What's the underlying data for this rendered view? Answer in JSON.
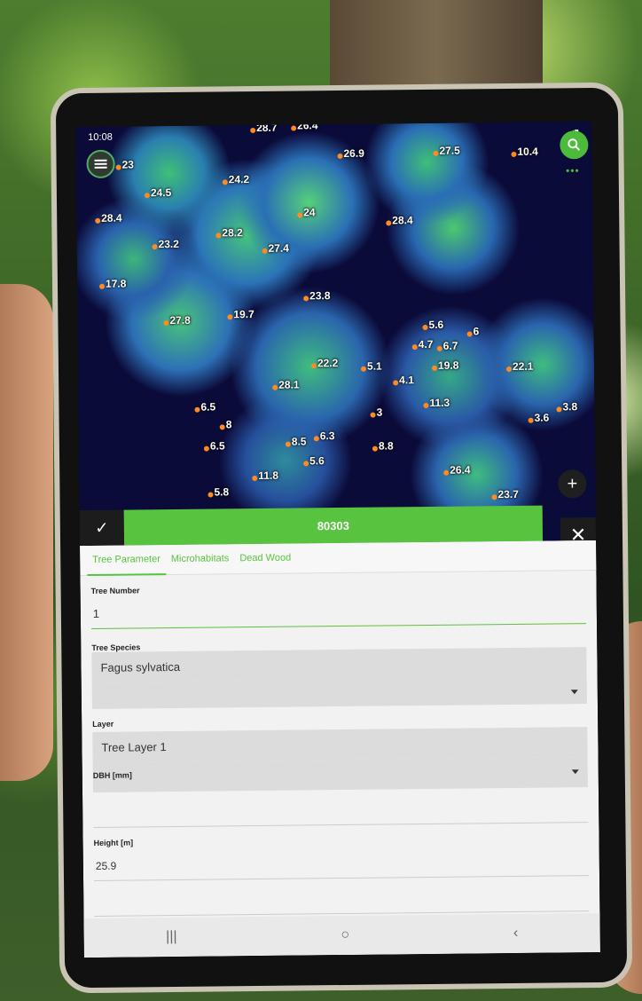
{
  "status_bar": {
    "time": "10:08",
    "signal": "◢▮"
  },
  "map": {
    "labels": [
      {
        "id": "l1",
        "text": "23"
      },
      {
        "id": "l2",
        "text": "24.5"
      },
      {
        "id": "l3",
        "text": "24.2"
      },
      {
        "id": "l4",
        "text": "26.9"
      },
      {
        "id": "l5",
        "text": "27.5"
      },
      {
        "id": "l6",
        "text": "10.4"
      },
      {
        "id": "l7",
        "text": "28.4"
      },
      {
        "id": "l8",
        "text": "23.2"
      },
      {
        "id": "l9",
        "text": "28.2"
      },
      {
        "id": "l10",
        "text": "27.4"
      },
      {
        "id": "l11",
        "text": "24"
      },
      {
        "id": "l12",
        "text": "28.4"
      },
      {
        "id": "l13",
        "text": "17.8"
      },
      {
        "id": "l14",
        "text": "23.8"
      },
      {
        "id": "l15",
        "text": "27.8"
      },
      {
        "id": "l16",
        "text": "19.7"
      },
      {
        "id": "l17",
        "text": "5.6"
      },
      {
        "id": "l18",
        "text": "6"
      },
      {
        "id": "l19",
        "text": "4.7"
      },
      {
        "id": "l20",
        "text": "6.7"
      },
      {
        "id": "l21",
        "text": "22.2"
      },
      {
        "id": "l22",
        "text": "5.1"
      },
      {
        "id": "l23",
        "text": "19.8"
      },
      {
        "id": "l24",
        "text": "22.1"
      },
      {
        "id": "l25",
        "text": "28.1"
      },
      {
        "id": "l26",
        "text": "4.1"
      },
      {
        "id": "l27",
        "text": "6.5"
      },
      {
        "id": "l28",
        "text": "11.3"
      },
      {
        "id": "l29",
        "text": "3"
      },
      {
        "id": "l30",
        "text": "3.6"
      },
      {
        "id": "l31",
        "text": "3.8"
      },
      {
        "id": "l32",
        "text": "8"
      },
      {
        "id": "l33",
        "text": "8.5"
      },
      {
        "id": "l34",
        "text": "6.3"
      },
      {
        "id": "l35",
        "text": "6.5"
      },
      {
        "id": "l36",
        "text": "8.8"
      },
      {
        "id": "l37",
        "text": "5.6"
      },
      {
        "id": "l38",
        "text": "11.8"
      },
      {
        "id": "l39",
        "text": "26.4"
      },
      {
        "id": "l40",
        "text": "5.8"
      },
      {
        "id": "l41",
        "text": "23.7"
      },
      {
        "id": "l42",
        "text": "28.7"
      },
      {
        "id": "l43",
        "text": "26.4"
      }
    ]
  },
  "form": {
    "title": "80303",
    "tabs": [
      "Tree Parameter",
      "Microhabitats",
      "Dead Wood"
    ],
    "tree_number": {
      "label": "Tree Number",
      "value": "1"
    },
    "tree_species": {
      "label": "Tree Species",
      "value": "Fagus sylvatica"
    },
    "layer": {
      "label": "Layer",
      "value": "Tree Layer 1"
    },
    "dbh": {
      "label": "DBH [mm]"
    },
    "height": {
      "label": "Height [m]",
      "value": "25.9"
    }
  },
  "icons": {
    "menu": "menu-icon",
    "search": "search-icon",
    "plus": "plus-icon",
    "check": "check-icon",
    "close": "close-icon"
  },
  "colors": {
    "accent": "#58c33f",
    "marker": "#ff8a1f"
  }
}
